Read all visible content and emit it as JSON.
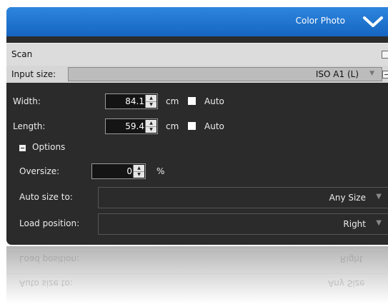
{
  "header": {
    "title": "Color Photo",
    "chevron_icon": "chevron-down-icon"
  },
  "scan": {
    "title": "Scan",
    "input_size": {
      "label": "Input size:",
      "value": "ISO A1 (L)"
    },
    "width": {
      "label": "Width:",
      "value": "84.1",
      "unit": "cm",
      "auto_label": "Auto"
    },
    "length": {
      "label": "Length:",
      "value": "59.4",
      "unit": "cm",
      "auto_label": "Auto"
    },
    "options": {
      "label": "Options",
      "oversize": {
        "label": "Oversize:",
        "value": "0",
        "unit": "%"
      },
      "auto_size_to": {
        "label": "Auto size to:",
        "value": "Any Size"
      },
      "load_position": {
        "label": "Load position:",
        "value": "Right"
      }
    }
  },
  "reflection": {
    "load_position_label": "Load position:",
    "load_position_value": "Right",
    "auto_size_label": "Auto size to:",
    "auto_size_value": "Any Size"
  },
  "colors": {
    "header_blue": "#1f6fd0",
    "panel_bg": "#2b2b2b",
    "section_bar": "#dcdcdc"
  }
}
